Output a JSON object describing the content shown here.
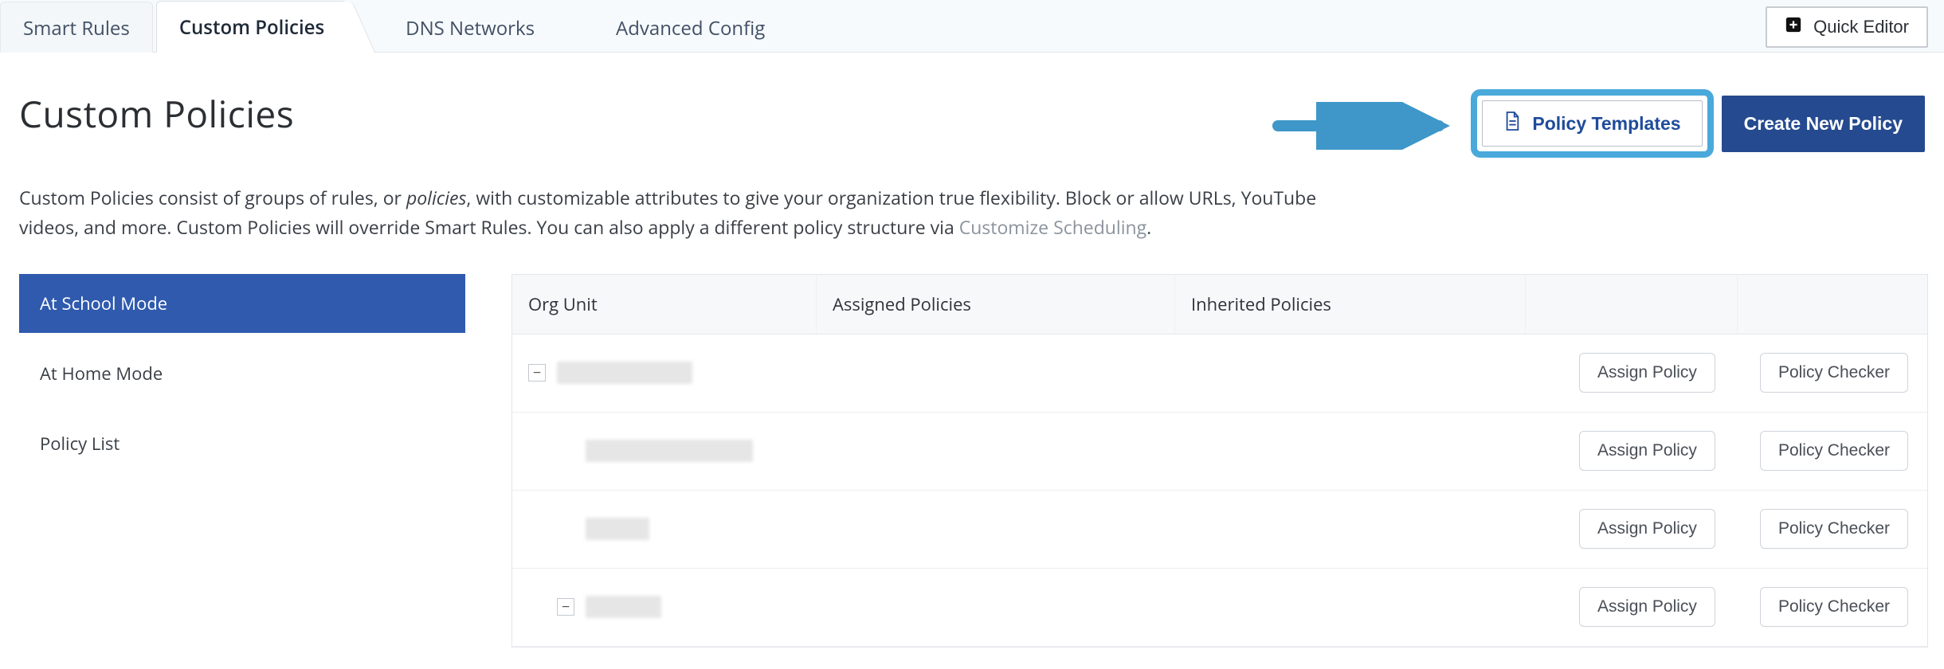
{
  "tabs": {
    "smart_rules": "Smart Rules",
    "custom_policies": "Custom Policies",
    "dns_networks": "DNS Networks",
    "advanced_config": "Advanced Config"
  },
  "quick_editor": "Quick Editor",
  "header": {
    "title": "Custom Policies",
    "policy_templates": "Policy Templates",
    "create_new": "Create New Policy"
  },
  "description": {
    "part1": "Custom Policies consist of groups of rules, or ",
    "policies_em": "policies",
    "part2": ", with customizable attributes to give your organization true flexibility. Block or allow URLs, YouTube videos, and more. Custom Policies will override Smart Rules. You can also apply a different policy structure via ",
    "link": "Customize Scheduling",
    "period": "."
  },
  "sidebar": {
    "items": [
      {
        "label": "At School Mode",
        "active": true
      },
      {
        "label": "At Home Mode",
        "active": false
      },
      {
        "label": "Policy List",
        "active": false
      }
    ]
  },
  "table": {
    "columns": {
      "org_unit": "Org Unit",
      "assigned": "Assigned Policies",
      "inherited": "Inherited Policies"
    },
    "actions": {
      "assign": "Assign Policy",
      "checker": "Policy Checker"
    },
    "rows": [
      {
        "indent": 0,
        "expander": "−",
        "redacted_width": 170
      },
      {
        "indent": 1,
        "expander": "",
        "redacted_width": 210
      },
      {
        "indent": 1,
        "expander": "",
        "redacted_width": 80
      },
      {
        "indent": 1,
        "expander": "−",
        "redacted_width": 95
      }
    ]
  },
  "colors": {
    "accent": "#2f5aae",
    "highlight_border": "#4aa9db",
    "dark_button": "#254a8f"
  }
}
